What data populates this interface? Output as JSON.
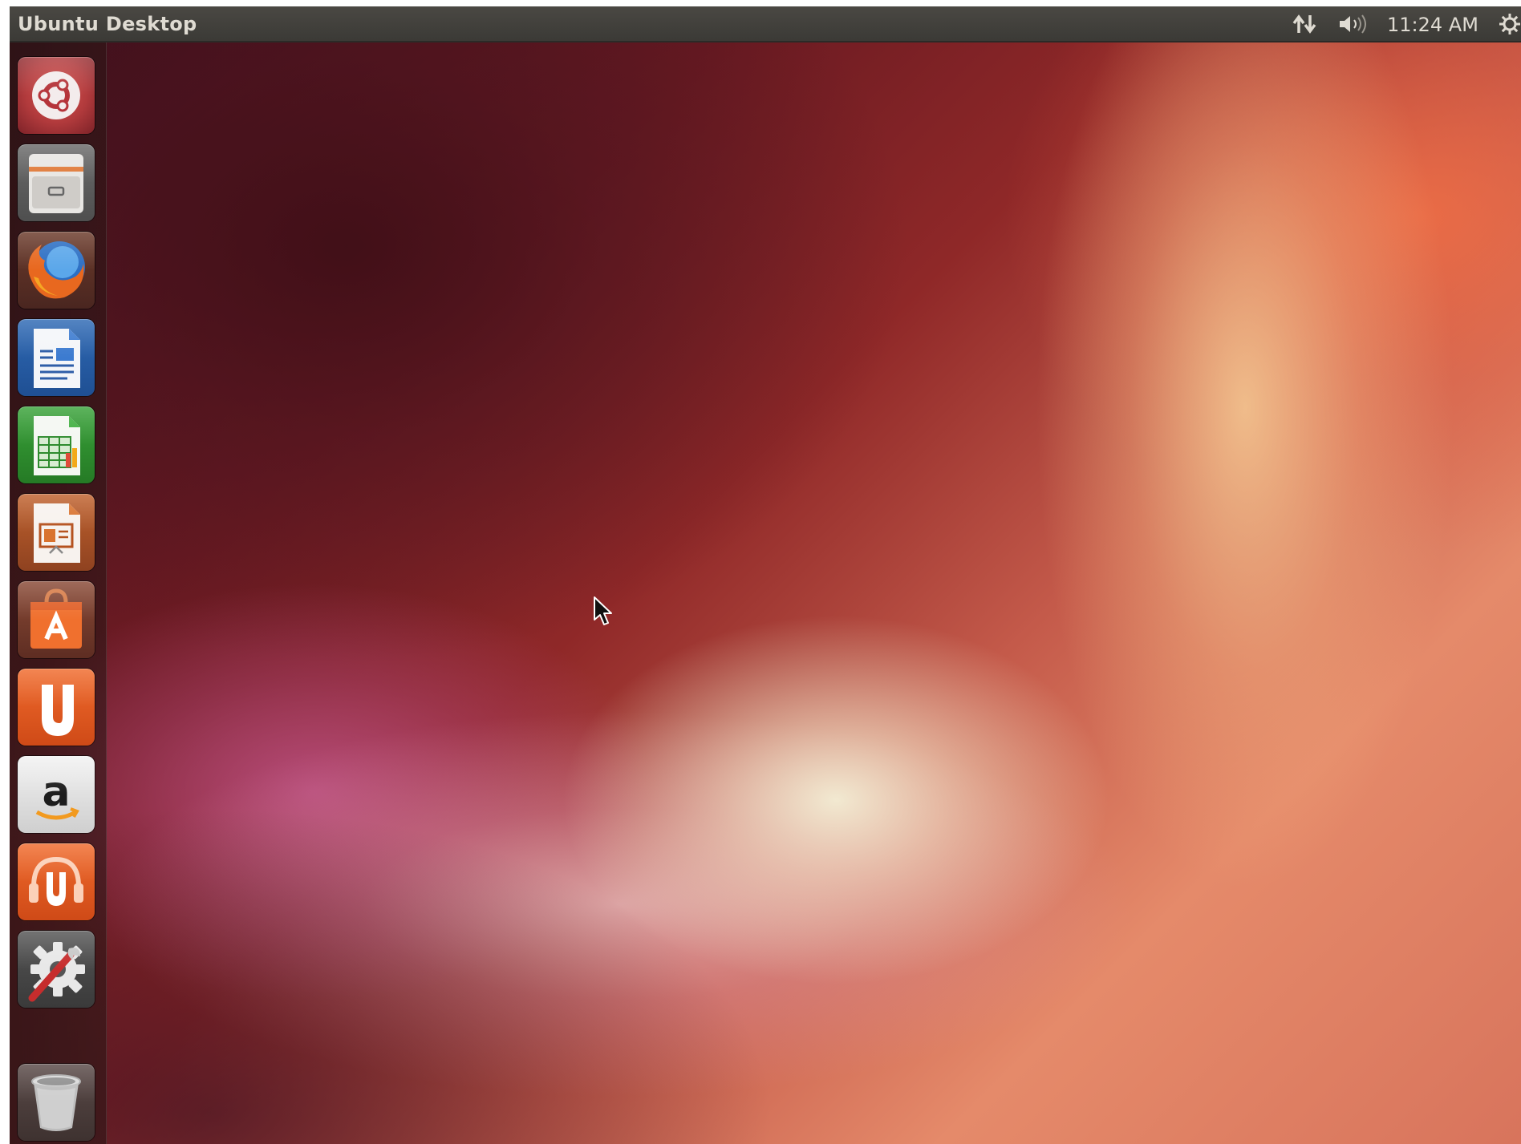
{
  "top_panel": {
    "title": "Ubuntu Desktop",
    "clock": "11:24 AM",
    "indicators": [
      "network-icon",
      "volume-icon",
      "session-gear-icon"
    ]
  },
  "launcher": {
    "items": [
      {
        "name": "dash-home",
        "icon": "ubuntu-logo-icon"
      },
      {
        "name": "files",
        "icon": "file-cabinet-icon"
      },
      {
        "name": "firefox",
        "icon": "firefox-icon"
      },
      {
        "name": "libreoffice-writer",
        "icon": "writer-document-icon"
      },
      {
        "name": "libreoffice-calc",
        "icon": "calc-spreadsheet-icon"
      },
      {
        "name": "libreoffice-impress",
        "icon": "impress-presentation-icon"
      },
      {
        "name": "ubuntu-software-center",
        "icon": "shopping-bag-icon"
      },
      {
        "name": "ubuntu-one",
        "icon": "ubuntu-one-icon"
      },
      {
        "name": "amazon",
        "icon": "amazon-icon"
      },
      {
        "name": "ubuntu-one-music",
        "icon": "ubuntu-one-music-icon"
      },
      {
        "name": "system-settings",
        "icon": "settings-gear-wrench-icon"
      },
      {
        "name": "trash",
        "icon": "trash-icon"
      }
    ],
    "amazon_letter": "a"
  },
  "colors": {
    "panel": "#3b3a36",
    "panel_text": "#dfdbd2",
    "ubuntu_orange": "#e95420",
    "wallpaper_dark": "#3a0f1d"
  }
}
